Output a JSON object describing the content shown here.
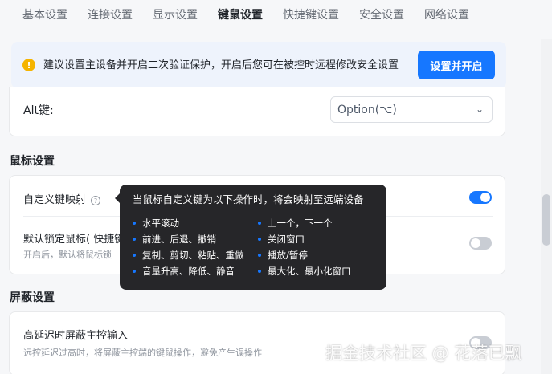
{
  "tabs": [
    {
      "label": "基本设置"
    },
    {
      "label": "连接设置"
    },
    {
      "label": "显示设置"
    },
    {
      "label": "键鼠设置"
    },
    {
      "label": "快捷键设置"
    },
    {
      "label": "安全设置"
    },
    {
      "label": "网络设置"
    }
  ],
  "active_tab": "键鼠设置",
  "banner": {
    "text": "建议设置主设备并开启二次验证保护，开启后您可在被控时远程修改安全设置",
    "button_label": "设置并开启",
    "icon": "warning-icon"
  },
  "keyboard": {
    "alt_label": "Alt键:",
    "alt_value": "Option(⌥)"
  },
  "mouse_section": {
    "title": "鼠标设置",
    "custom_key_label": "自定义键映射",
    "custom_key_enabled": true,
    "lock_label": "默认锁定鼠标( 快捷键",
    "lock_sub": "开启后，默认将鼠标锁",
    "lock_enabled": false
  },
  "tooltip": {
    "title": "当鼠标自定义键为以下操作时，将会映射至远端设备",
    "left_items": [
      "水平滚动",
      "前进、后退、撤销",
      "复制、剪切、粘贴、重做",
      "音量升高、降低、静音"
    ],
    "right_items": [
      "上一个，下一个",
      "关闭窗口",
      "播放/暂停",
      "最大化、最小化窗口"
    ]
  },
  "screen_section": {
    "title": "屏蔽设置",
    "latency_label": "高延迟时屏蔽主控输入",
    "latency_sub": "远控延迟过高时，将屏蔽主控端的键鼠操作，避免产生误操作",
    "latency_enabled": false
  },
  "watermark": "掘金技术社区 @ 花落已飘",
  "colors": {
    "accent": "#1677ff",
    "warning": "#f5b400",
    "tooltip_bg": "#262629"
  }
}
